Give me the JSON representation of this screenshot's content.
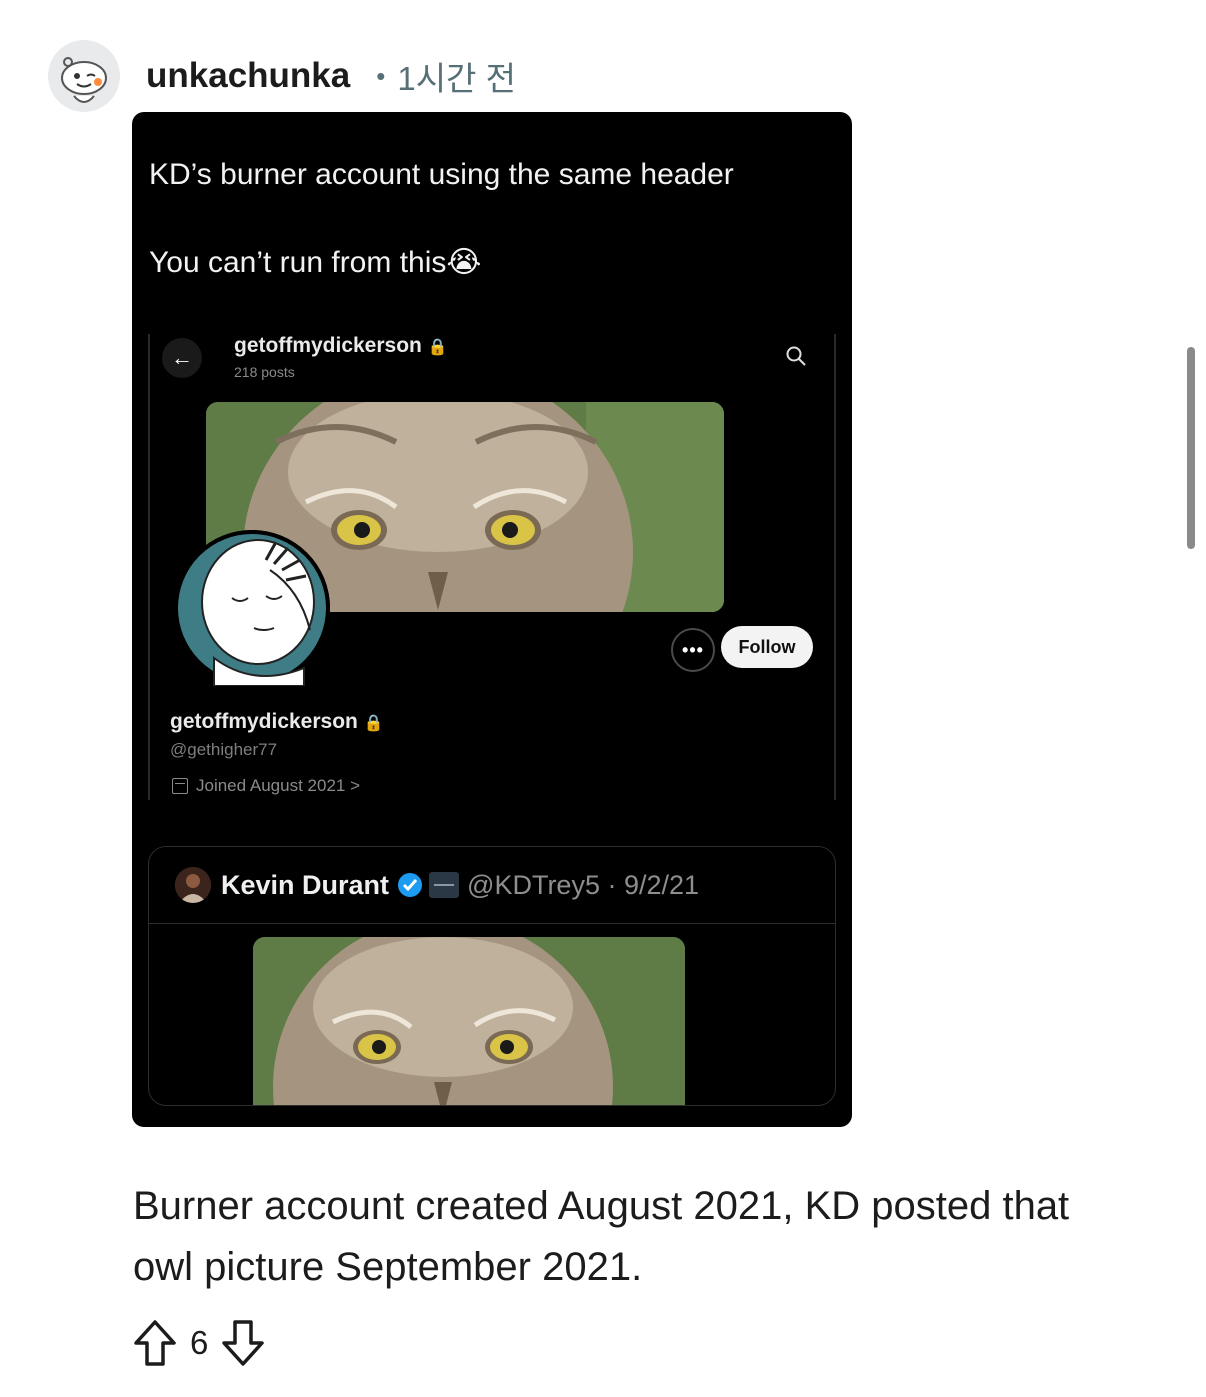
{
  "comment": {
    "username": "unkachunka",
    "separator": "•",
    "time_ago": "1시간 전",
    "body": "Burner account created August 2021, KD posted that owl picture September 2021.",
    "score": "6"
  },
  "embed": {
    "tweet_line1": "KD’s burner account using the same header",
    "tweet_line2": "You can’t run from this😭",
    "profile": {
      "back_glyph": "←",
      "title": "getoffmydickerson",
      "posts": "218 posts",
      "more_label": "•••",
      "follow_label": "Follow",
      "name": "getoffmydickerson",
      "handle": "@gethigher77",
      "joined": "Joined August 2021",
      "joined_chevron": ">"
    },
    "quote": {
      "name": "Kevin Durant",
      "handle_date": "@KDTrey5 · 9/2/21"
    }
  },
  "icons": [
    "reddit-avatar-icon",
    "lock-icon",
    "search-icon",
    "calendar-icon",
    "verified-icon",
    "upvote-icon",
    "downvote-icon"
  ],
  "colors": {
    "meta_gray": "#576f76",
    "verified_blue": "#1d9bf0",
    "embed_bg": "#000000"
  }
}
